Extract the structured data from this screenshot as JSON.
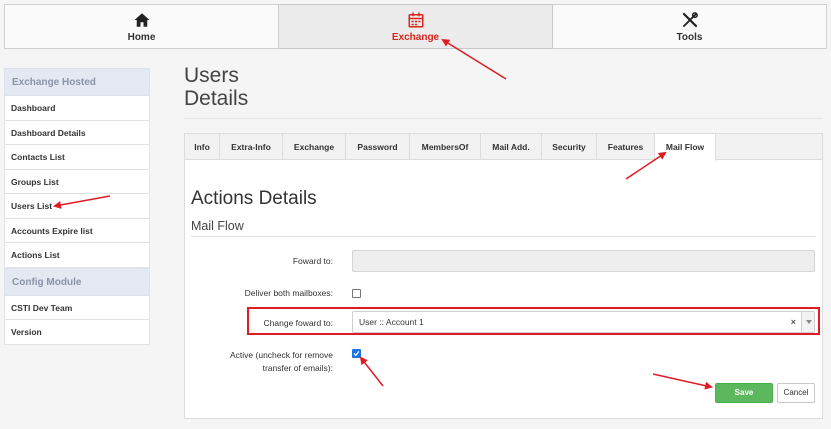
{
  "nav": {
    "home_label": "Home",
    "exchange_label": "Exchange",
    "tools_label": "Tools"
  },
  "sidebar": {
    "section1_title": "Exchange Hosted",
    "items1": [
      "Dashboard",
      "Dashboard Details",
      "Contacts List",
      "Groups List",
      "Users List",
      "Accounts Expire list",
      "Actions List"
    ],
    "section2_title": "Config Module",
    "items2": [
      "CSTI Dev Team",
      "Version"
    ]
  },
  "page": {
    "title_line1": "Users",
    "title_line2": "Details"
  },
  "tabs": [
    "Info",
    "Extra-Info",
    "Exchange",
    "Password",
    "MembersOf",
    "Mail Add.",
    "Security",
    "Features",
    "Mail Flow"
  ],
  "active_tab": "Mail Flow",
  "section": {
    "title": "Actions Details",
    "subtitle": "Mail Flow"
  },
  "form": {
    "forward_to_label": "Foward to:",
    "forward_to_value": "",
    "deliver_both_label": "Deliver both mailboxes:",
    "deliver_both_checked": false,
    "change_forward_label": "Change foward to:",
    "change_forward_value": "User :: Account 1",
    "clear_symbol": "×",
    "active_label_line1": "Active (uncheck for remove",
    "active_label_line2": "transfer of emails):",
    "active_checked": true
  },
  "buttons": {
    "save_label": "Save",
    "cancel_label": "Cancel"
  },
  "colors": {
    "accent_red": "#d9261c",
    "highlight_red": "#e01b24",
    "save_green": "#5cb85c",
    "checkbox_blue": "#1a73e8"
  }
}
